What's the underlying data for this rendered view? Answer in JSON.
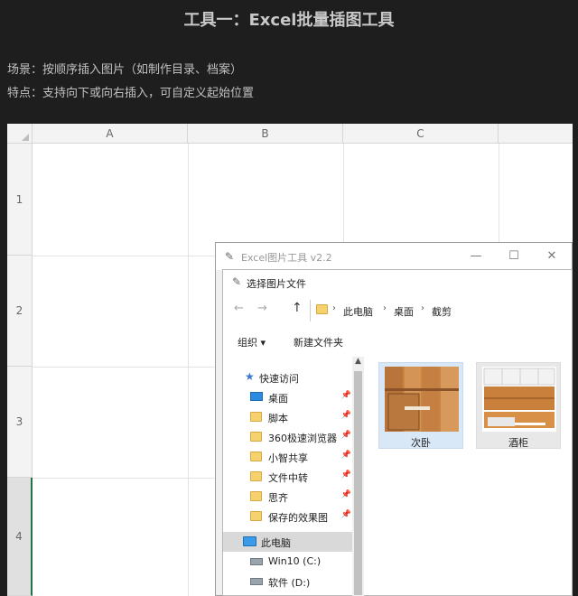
{
  "header": {
    "title": "工具一：Excel批量插图工具",
    "line1": "场景：按顺序插入图片（如制作目录、档案）",
    "line2": "特点：支持向下或向右插入，可自定义起始位置"
  },
  "excel": {
    "columns": [
      "A",
      "B",
      "C"
    ],
    "rows": [
      "1",
      "2",
      "3",
      "4"
    ],
    "accent": "#217346"
  },
  "tool_window": {
    "title": "Excel图片工具 v2.2",
    "controls": [
      "—",
      "☐",
      "✕"
    ]
  },
  "dialog": {
    "title": "选择图片文件",
    "back": "←",
    "forward": "→",
    "up": "↑",
    "breadcrumb": [
      "此电脑",
      "桌面",
      "截剪"
    ],
    "organize": "组织 ▾",
    "new_folder": "新建文件夹",
    "nav": {
      "quick_access": "快速访问",
      "items": [
        "桌面",
        "脚本",
        "360极速浏览器X",
        "小智共享",
        "文件中转",
        "思齐",
        "保存的效果图"
      ],
      "this_pc": "此电脑",
      "drives": [
        "Win10 (C:)",
        "软件 (D:)"
      ]
    },
    "files": [
      "次卧",
      "酒柜"
    ]
  }
}
